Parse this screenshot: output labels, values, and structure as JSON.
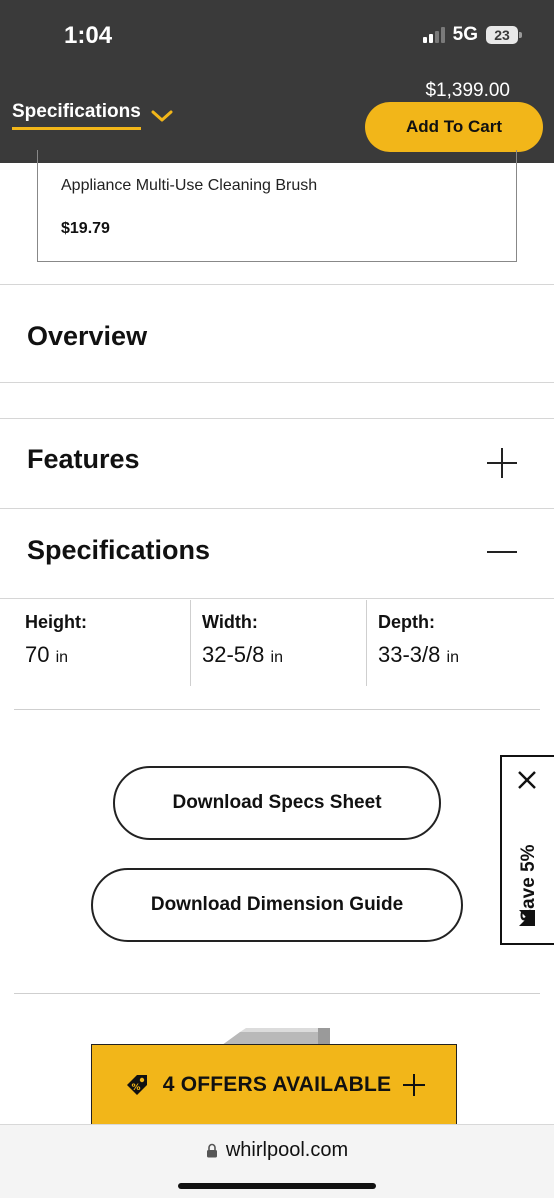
{
  "status_bar": {
    "time": "1:04",
    "network": "5G",
    "battery": "23"
  },
  "sticky_header": {
    "section_label": "Specifications",
    "price": "$1,399.00",
    "add_to_cart_label": "Add To Cart"
  },
  "accessory": {
    "name": "Appliance Multi-Use Cleaning Brush",
    "price": "$19.79"
  },
  "sections": {
    "overview": "Overview",
    "features": "Features",
    "specifications": "Specifications"
  },
  "dimensions": [
    {
      "label": "Height:",
      "value": "70",
      "unit": "in"
    },
    {
      "label": "Width:",
      "value": "32-5/8",
      "unit": "in"
    },
    {
      "label": "Depth:",
      "value": "33-3/8",
      "unit": "in"
    }
  ],
  "downloads": {
    "specs_sheet": "Download Specs Sheet",
    "dimension_guide": "Download Dimension Guide"
  },
  "save_tab": {
    "label": "Save 5%",
    "icons": [
      "close-icon",
      "brand-logo-icon"
    ]
  },
  "offers": {
    "label": "4 OFFERS AVAILABLE"
  },
  "browser": {
    "url": "whirlpool.com"
  },
  "colors": {
    "header_bg": "#3a3a3a",
    "accent": "#f2b619",
    "text": "#111111",
    "divider": "#d6d6d6"
  }
}
